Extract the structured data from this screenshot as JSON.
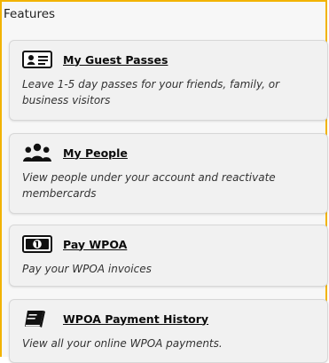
{
  "header": {
    "title": "Features"
  },
  "features": [
    {
      "title": "My Guest Passes",
      "description": "Leave 1-5 day passes for your friends, family, or business visitors",
      "icon": "id-card-icon"
    },
    {
      "title": "My People",
      "description": "View people under your account and reactivate membercards",
      "icon": "people-icon"
    },
    {
      "title": "Pay WPOA",
      "description": "Pay your WPOA invoices",
      "icon": "money-bill-icon"
    },
    {
      "title": "WPOA Payment History",
      "description": "View all your online WPOA payments.",
      "icon": "book-icon"
    }
  ]
}
